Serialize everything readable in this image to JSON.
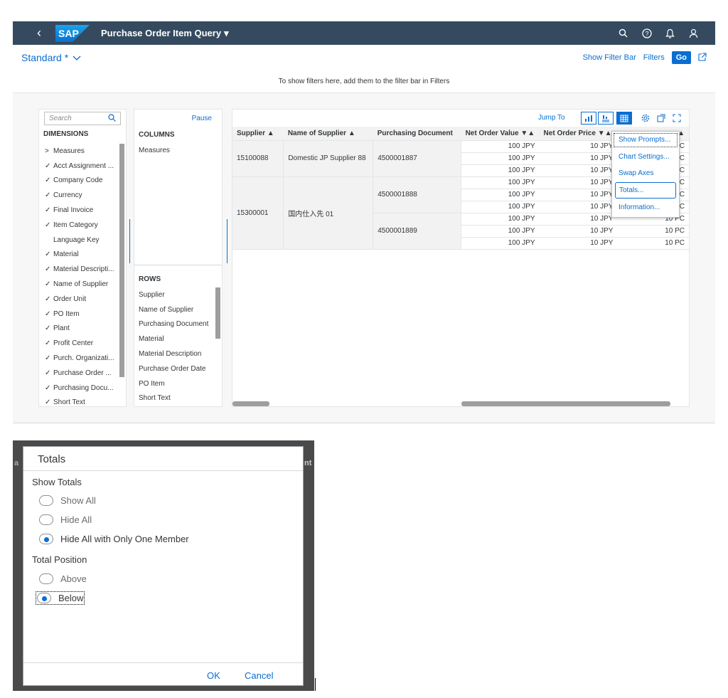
{
  "shell": {
    "logo_text": "SAP",
    "app_title": "Purchase Order Item Query",
    "title_caret": "▾"
  },
  "header": {
    "variant": "Standard *",
    "show_filter_bar": "Show Filter Bar",
    "filters": "Filters",
    "go": "Go",
    "filter_hint": "To show filters here, add them to the filter bar in Filters"
  },
  "dimensions": {
    "search_placeholder": "Search",
    "header": "DIMENSIONS",
    "items": [
      {
        "mark": ">",
        "label": "Measures"
      },
      {
        "mark": "✓",
        "label": "Acct Assignment ..."
      },
      {
        "mark": "✓",
        "label": "Company Code"
      },
      {
        "mark": "✓",
        "label": "Currency"
      },
      {
        "mark": "✓",
        "label": "Final Invoice"
      },
      {
        "mark": "✓",
        "label": "Item Category"
      },
      {
        "mark": "",
        "label": "Language Key"
      },
      {
        "mark": "✓",
        "label": "Material"
      },
      {
        "mark": "✓",
        "label": "Material Descripti..."
      },
      {
        "mark": "✓",
        "label": "Name of Supplier"
      },
      {
        "mark": "✓",
        "label": "Order Unit"
      },
      {
        "mark": "✓",
        "label": "PO Item"
      },
      {
        "mark": "✓",
        "label": "Plant"
      },
      {
        "mark": "✓",
        "label": "Profit Center"
      },
      {
        "mark": "✓",
        "label": "Purch. Organizati..."
      },
      {
        "mark": "✓",
        "label": "Purchase Order ..."
      },
      {
        "mark": "✓",
        "label": "Purchasing Docu..."
      },
      {
        "mark": "✓",
        "label": "Short Text"
      }
    ]
  },
  "layout_panel": {
    "pause": "Pause",
    "columns_header": "COLUMNS",
    "columns_items": [
      "Measures"
    ],
    "rows_header": "ROWS",
    "rows_items": [
      "Supplier",
      "Name of Supplier",
      "Purchasing Document",
      "Material",
      "Material Description",
      "Purchase Order Date",
      "PO Item",
      "Short Text"
    ]
  },
  "table": {
    "jump_to": "Jump To",
    "headers": [
      "Supplier ▲",
      "Name of Supplier ▲",
      "Purchasing Document",
      "Net Order Value ▼▲",
      "Net Order Price ▼▲",
      "▼▲"
    ],
    "groups": [
      {
        "supplier": "15100088",
        "name": "Domestic JP Supplier 88",
        "docs": [
          {
            "doc": "4500001887",
            "rows": [
              [
                "100 JPY",
                "10 JPY",
                "PC"
              ],
              [
                "100 JPY",
                "10 JPY",
                "PC"
              ],
              [
                "100 JPY",
                "10 JPY",
                "PC"
              ]
            ]
          }
        ]
      },
      {
        "supplier": "15300001",
        "name": "国内仕入先 01",
        "docs": [
          {
            "doc": "4500001888",
            "rows": [
              [
                "100 JPY",
                "10 JPY",
                "PC"
              ],
              [
                "100 JPY",
                "10 JPY",
                "PC"
              ],
              [
                "100 JPY",
                "10 JPY",
                "PC"
              ]
            ]
          },
          {
            "doc": "4500001889",
            "rows": [
              [
                "100 JPY",
                "10 JPY",
                "10 PC"
              ],
              [
                "100 JPY",
                "10 JPY",
                "10 PC"
              ],
              [
                "100 JPY",
                "10 JPY",
                "10 PC"
              ]
            ]
          }
        ]
      }
    ]
  },
  "context_menu": {
    "items": [
      "Show Prompts...",
      "Chart Settings...",
      "Swap Axes",
      "Totals...",
      "Information..."
    ]
  },
  "dialog": {
    "title": "Totals",
    "show_totals_label": "Show Totals",
    "show_totals_options": [
      {
        "label": "Show All",
        "selected": false
      },
      {
        "label": "Hide All",
        "selected": false
      },
      {
        "label": "Hide All with Only One Member",
        "selected": true
      }
    ],
    "position_label": "Total Position",
    "position_options": [
      {
        "label": "Above",
        "selected": false
      },
      {
        "label": "Below",
        "selected": true
      }
    ],
    "ok": "OK",
    "cancel": "Cancel",
    "peek_left": "a",
    "peek_right": "nt"
  },
  "colors": {
    "shell": "#354a5f",
    "accent": "#0a6ed1"
  }
}
